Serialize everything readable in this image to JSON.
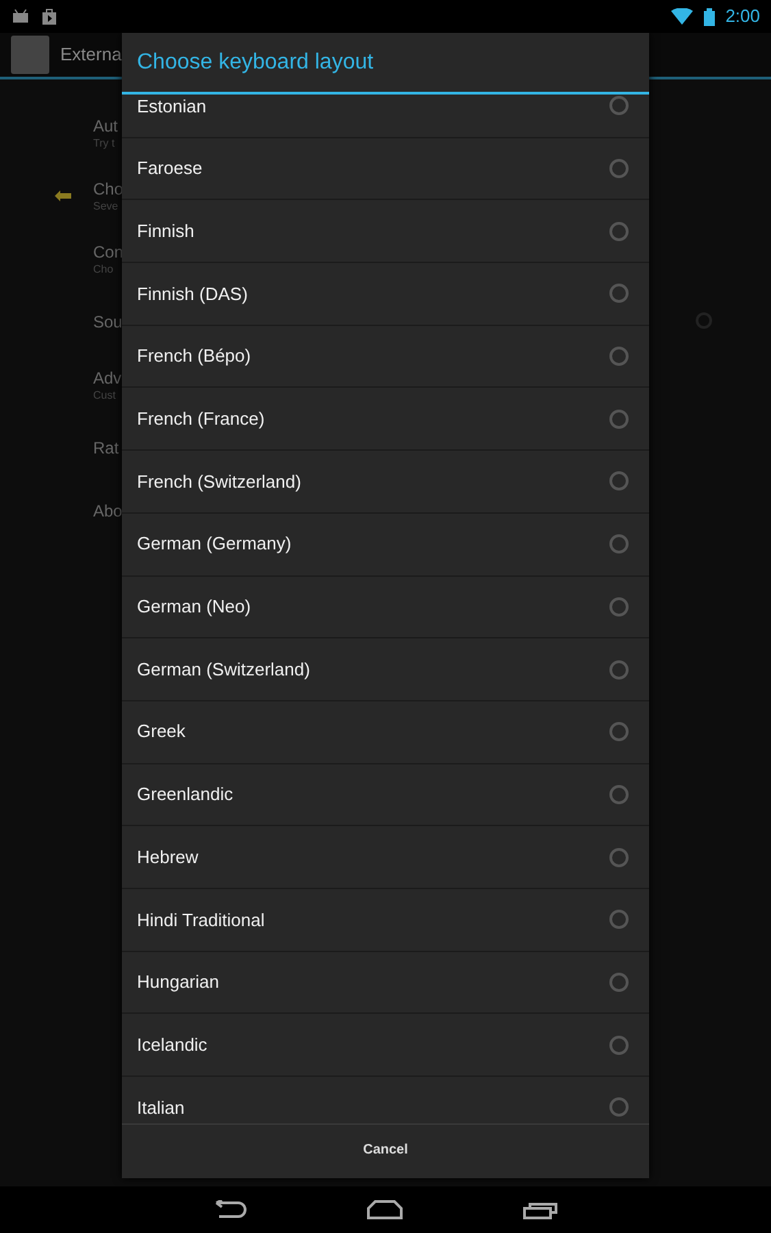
{
  "status_bar": {
    "time": "2:00"
  },
  "action_bar": {
    "title": "Externa"
  },
  "settings": [
    {
      "title": "Aut",
      "subtitle": "Try t"
    },
    {
      "title": "Cho",
      "subtitle": "Seve",
      "kind": "arrow"
    },
    {
      "title": "Con",
      "subtitle": "Cho"
    },
    {
      "title": "Sou",
      "kind": "toggle"
    },
    {
      "title": "Adv",
      "subtitle": "Cust"
    },
    {
      "title": "Rat"
    },
    {
      "title": "Abo"
    }
  ],
  "dialog": {
    "title": "Choose keyboard layout",
    "options": [
      {
        "label": "Estonian",
        "selected": false
      },
      {
        "label": "Faroese",
        "selected": false
      },
      {
        "label": "Finnish",
        "selected": false
      },
      {
        "label": "Finnish (DAS)",
        "selected": false
      },
      {
        "label": "French (Bépo)",
        "selected": false
      },
      {
        "label": "French (France)",
        "selected": false
      },
      {
        "label": "French (Switzerland)",
        "selected": false
      },
      {
        "label": "German (Germany)",
        "selected": false
      },
      {
        "label": "German (Neo)",
        "selected": false
      },
      {
        "label": "German (Switzerland)",
        "selected": false
      },
      {
        "label": "Greek",
        "selected": false
      },
      {
        "label": "Greenlandic",
        "selected": false
      },
      {
        "label": "Hebrew",
        "selected": false
      },
      {
        "label": "Hindi Traditional",
        "selected": false
      },
      {
        "label": "Hungarian",
        "selected": false
      },
      {
        "label": "Icelandic",
        "selected": false
      },
      {
        "label": "Italian",
        "selected": false
      }
    ],
    "buttons": [
      "Cancel"
    ]
  }
}
